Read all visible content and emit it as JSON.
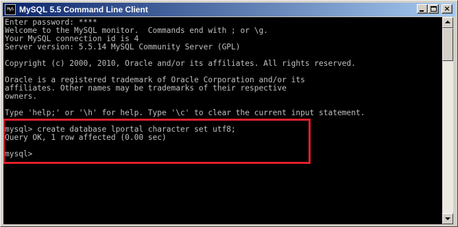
{
  "window": {
    "title": "MySQL 5.5 Command Line Client",
    "icon_label": "MyS",
    "controls": [
      "minimize-icon",
      "maximize-icon",
      "close-icon"
    ],
    "close_glyph": "×"
  },
  "console": {
    "lines": [
      "Enter password: ****",
      "Welcome to the MySQL monitor.  Commands end with ; or \\g.",
      "Your MySQL connection id is 4",
      "Server version: 5.5.14 MySQL Community Server (GPL)",
      "",
      "Copyright (c) 2000, 2010, Oracle and/or its affiliates. All rights reserved.",
      "",
      "Oracle is a registered trademark of Oracle Corporation and/or its",
      "affiliates. Other names may be trademarks of their respective",
      "owners.",
      "",
      "Type 'help;' or '\\h' for help. Type '\\c' to clear the current input statement.",
      "",
      "mysql> create database lportal character set utf8;",
      "Query OK, 1 row affected (0.00 sec)",
      "",
      "mysql> "
    ],
    "highlight_color": "#e3202c",
    "text_color": "#c0c0c0",
    "background": "#000000"
  }
}
